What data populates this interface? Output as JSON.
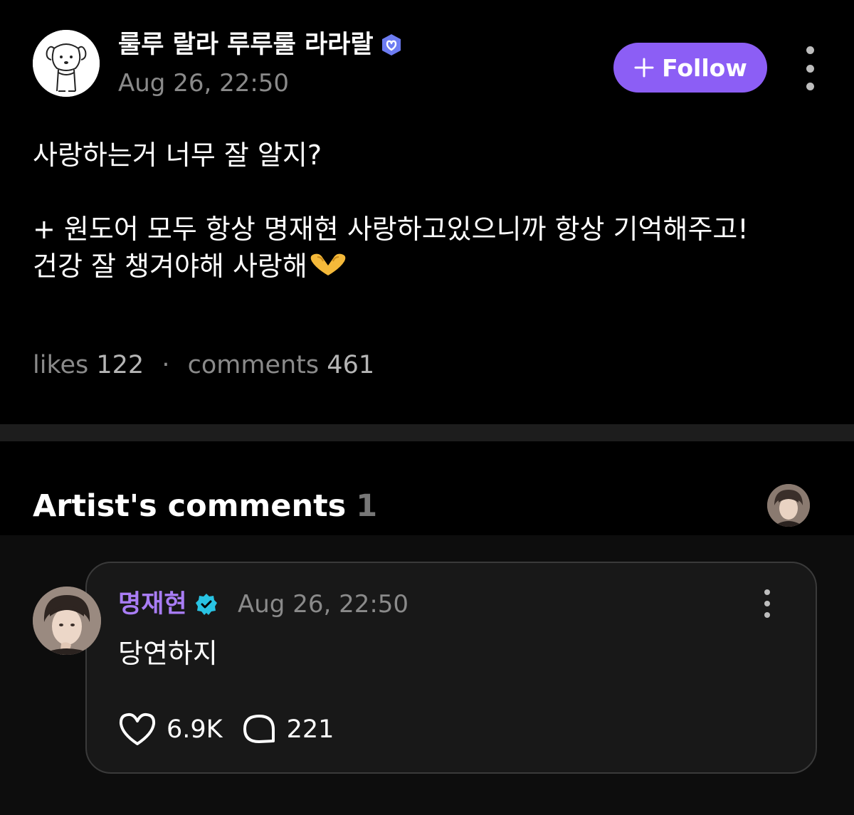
{
  "post": {
    "author": "룰루 랄라 루루룰 라라랄",
    "timestamp": "Aug 26, 22:50",
    "follow_label": "Follow",
    "lines": [
      "사랑하는거 너무 잘 알지?",
      "+ 원도어 모두 항상 명재현 사랑하고있으니까 항상 기억해주고!",
      "건강 잘 챙겨야해 사랑해"
    ],
    "emoji": "heart-hands-emoji",
    "likes_label": "likes",
    "likes_count": "122",
    "separator": "·",
    "comments_label": "comments",
    "comments_count": "461"
  },
  "artist_comments": {
    "title": "Artist's comments",
    "count": "1",
    "comment": {
      "author": "명재현",
      "timestamp": "Aug 26, 22:50",
      "text": "당연하지",
      "likes": "6.9K",
      "replies": "221"
    }
  },
  "colors": {
    "background": "#000000",
    "accent": "#8c5ef5",
    "artist_name": "#a97df5",
    "verified_fan": "#6d7cf2",
    "verified_artist": "#29c3e3",
    "muted": "#8a8a8a"
  }
}
